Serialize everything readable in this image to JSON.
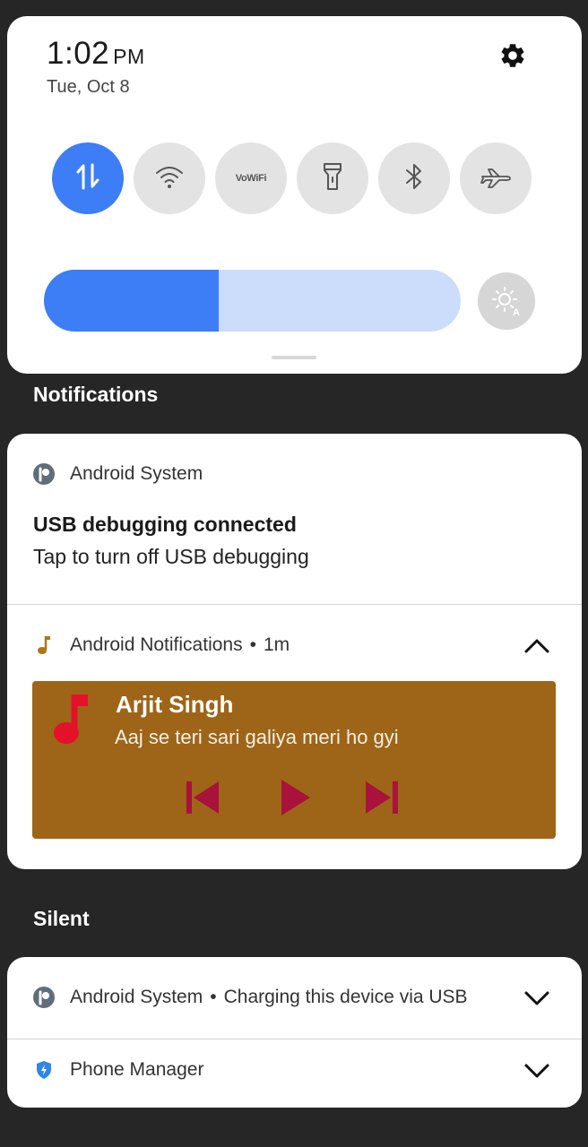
{
  "status": {
    "time": "1:02",
    "ampm": "PM",
    "date": "Tue, Oct 8"
  },
  "quick_tiles": [
    {
      "icon": "mobile-data-icon",
      "active": true
    },
    {
      "icon": "wifi-icon",
      "active": false
    },
    {
      "icon": "vowifi-icon",
      "label": "VoWiFi",
      "active": false
    },
    {
      "icon": "flashlight-icon",
      "active": false
    },
    {
      "icon": "bluetooth-icon",
      "active": false
    },
    {
      "icon": "airplane-mode-icon",
      "active": false
    }
  ],
  "brightness": {
    "level": 0.42
  },
  "notifications": {
    "section_title": "Notifications",
    "usb": {
      "app": "Android System",
      "title": "USB debugging connected",
      "text": "Tap to turn off USB debugging"
    },
    "media": {
      "app": "Android Notifications",
      "time": "1m",
      "artist": "Arjit Singh",
      "song": "Aaj se teri sari galiya meri ho gyi"
    }
  },
  "silent": {
    "section_title": "Silent",
    "charging": {
      "app": "Android System",
      "text": "Charging this device via USB"
    },
    "phone_manager": {
      "app": "Phone Manager"
    }
  },
  "colors": {
    "accent": "#3d7ef6",
    "media_background": "#9e6518",
    "media_controls": "#a8123b",
    "note_icon": "#e3122a"
  }
}
